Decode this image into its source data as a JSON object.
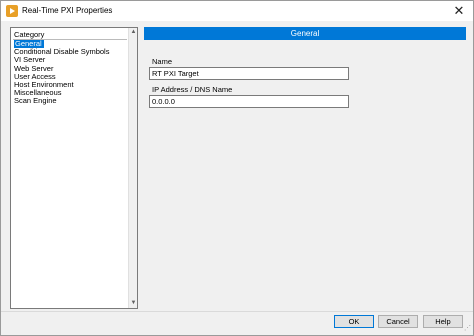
{
  "window": {
    "title": "Real-Time PXI Properties",
    "close_glyph": "✕"
  },
  "category": {
    "header": "Category",
    "items": [
      "General",
      "Conditional Disable Symbols",
      "VI Server",
      "Web Server",
      "User Access",
      "Host Environment",
      "Miscellaneous",
      "Scan Engine"
    ],
    "selected_index": 0
  },
  "general": {
    "header": "General",
    "name_label": "Name",
    "name_value": "RT PXI Target",
    "ip_label": "IP Address / DNS Name",
    "ip_value": "0.0.0.0"
  },
  "buttons": {
    "ok": "OK",
    "cancel": "Cancel",
    "help": "Help"
  },
  "colors": {
    "accent": "#0078d7",
    "app_icon": "#e8a028"
  },
  "icons": {
    "app": "labview-icon",
    "close": "close-icon",
    "scroll_up": "arrow-up-icon",
    "scroll_down": "arrow-down-icon"
  }
}
